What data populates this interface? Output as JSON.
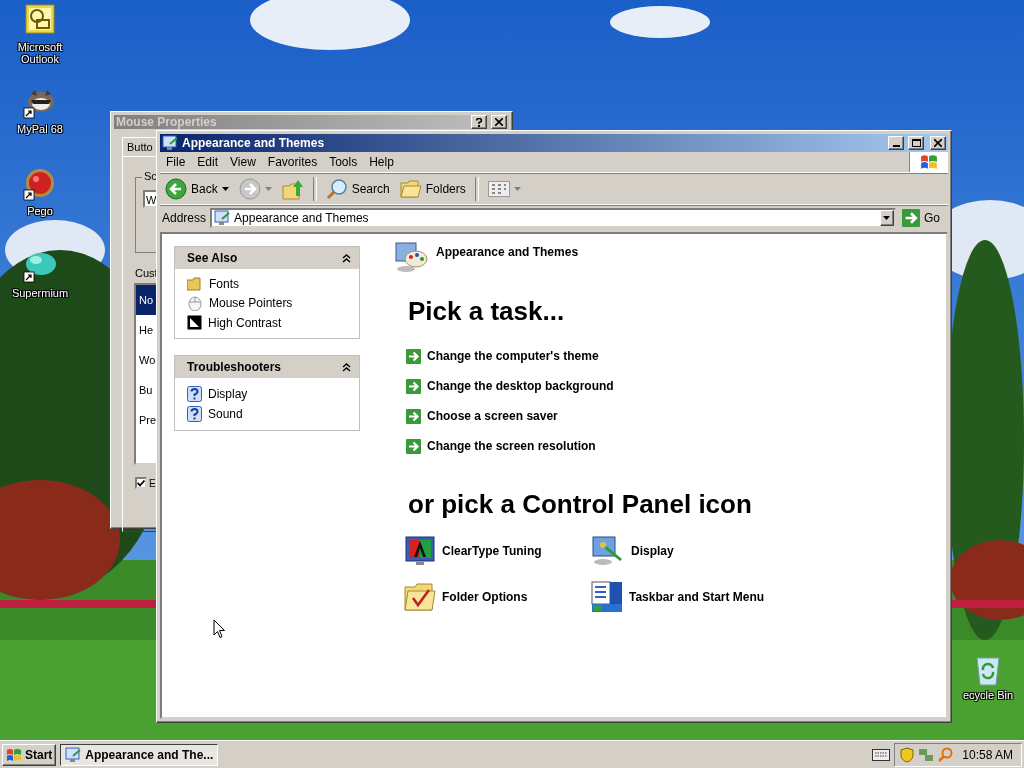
{
  "desktop_icons": [
    {
      "label": "Microsoft Outlook",
      "kind": "outlook",
      "shortcut": false
    },
    {
      "label": "MyPal 68",
      "kind": "raccoon",
      "shortcut": true
    },
    {
      "label": "Pego",
      "kind": "ball",
      "shortcut": true
    },
    {
      "label": "Supermium",
      "kind": "gem",
      "shortcut": true
    }
  ],
  "recycle_bin": {
    "label": "ecycle Bin"
  },
  "mouse_properties": {
    "title": "Mouse Properties",
    "tab": "Butto",
    "group_label": "Sc",
    "field_value": "W",
    "list_label": "Cust",
    "list_items": [
      {
        "label": "No",
        "selected": true
      },
      {
        "label": "He",
        "selected": false
      },
      {
        "label": "Wo",
        "selected": false
      },
      {
        "label": "Bu",
        "selected": false
      },
      {
        "label": "Pre",
        "selected": false
      }
    ],
    "checkbox": {
      "label": "E",
      "checked": true
    }
  },
  "window": {
    "title": "Appearance and Themes",
    "menu": [
      "File",
      "Edit",
      "View",
      "Favorites",
      "Tools",
      "Help"
    ],
    "toolbar": {
      "back": "Back",
      "search": "Search",
      "folders": "Folders"
    },
    "address": {
      "label": "Address",
      "value": "Appearance and Themes",
      "go": "Go"
    },
    "side_panes": [
      {
        "title": "See Also",
        "expanded": true,
        "items": [
          {
            "label": "Fonts",
            "kind": "fonts"
          },
          {
            "label": "Mouse Pointers",
            "kind": "mouse"
          },
          {
            "label": "High Contrast",
            "kind": "contrast"
          }
        ]
      },
      {
        "title": "Troubleshooters",
        "expanded": true,
        "items": [
          {
            "label": "Display",
            "kind": "help"
          },
          {
            "label": "Sound",
            "kind": "help"
          }
        ]
      }
    ],
    "header": "Appearance and Themes",
    "task_heading": "Pick a task...",
    "tasks": [
      "Change the computer's theme",
      "Change the desktop background",
      "Choose a screen saver",
      "Change the screen resolution"
    ],
    "icon_heading": "or pick a Control Panel icon",
    "icons": [
      {
        "label": "ClearType Tuning",
        "kind": "cleartype"
      },
      {
        "label": "Display",
        "kind": "display"
      },
      {
        "label": "Folder Options",
        "kind": "folderoptions"
      },
      {
        "label": "Taskbar and Start Menu",
        "kind": "taskbar"
      }
    ]
  },
  "taskbar": {
    "start": "Start",
    "tasks": [
      {
        "label": "Appearance and The...",
        "selected": true
      }
    ],
    "clock": "10:58 AM"
  }
}
